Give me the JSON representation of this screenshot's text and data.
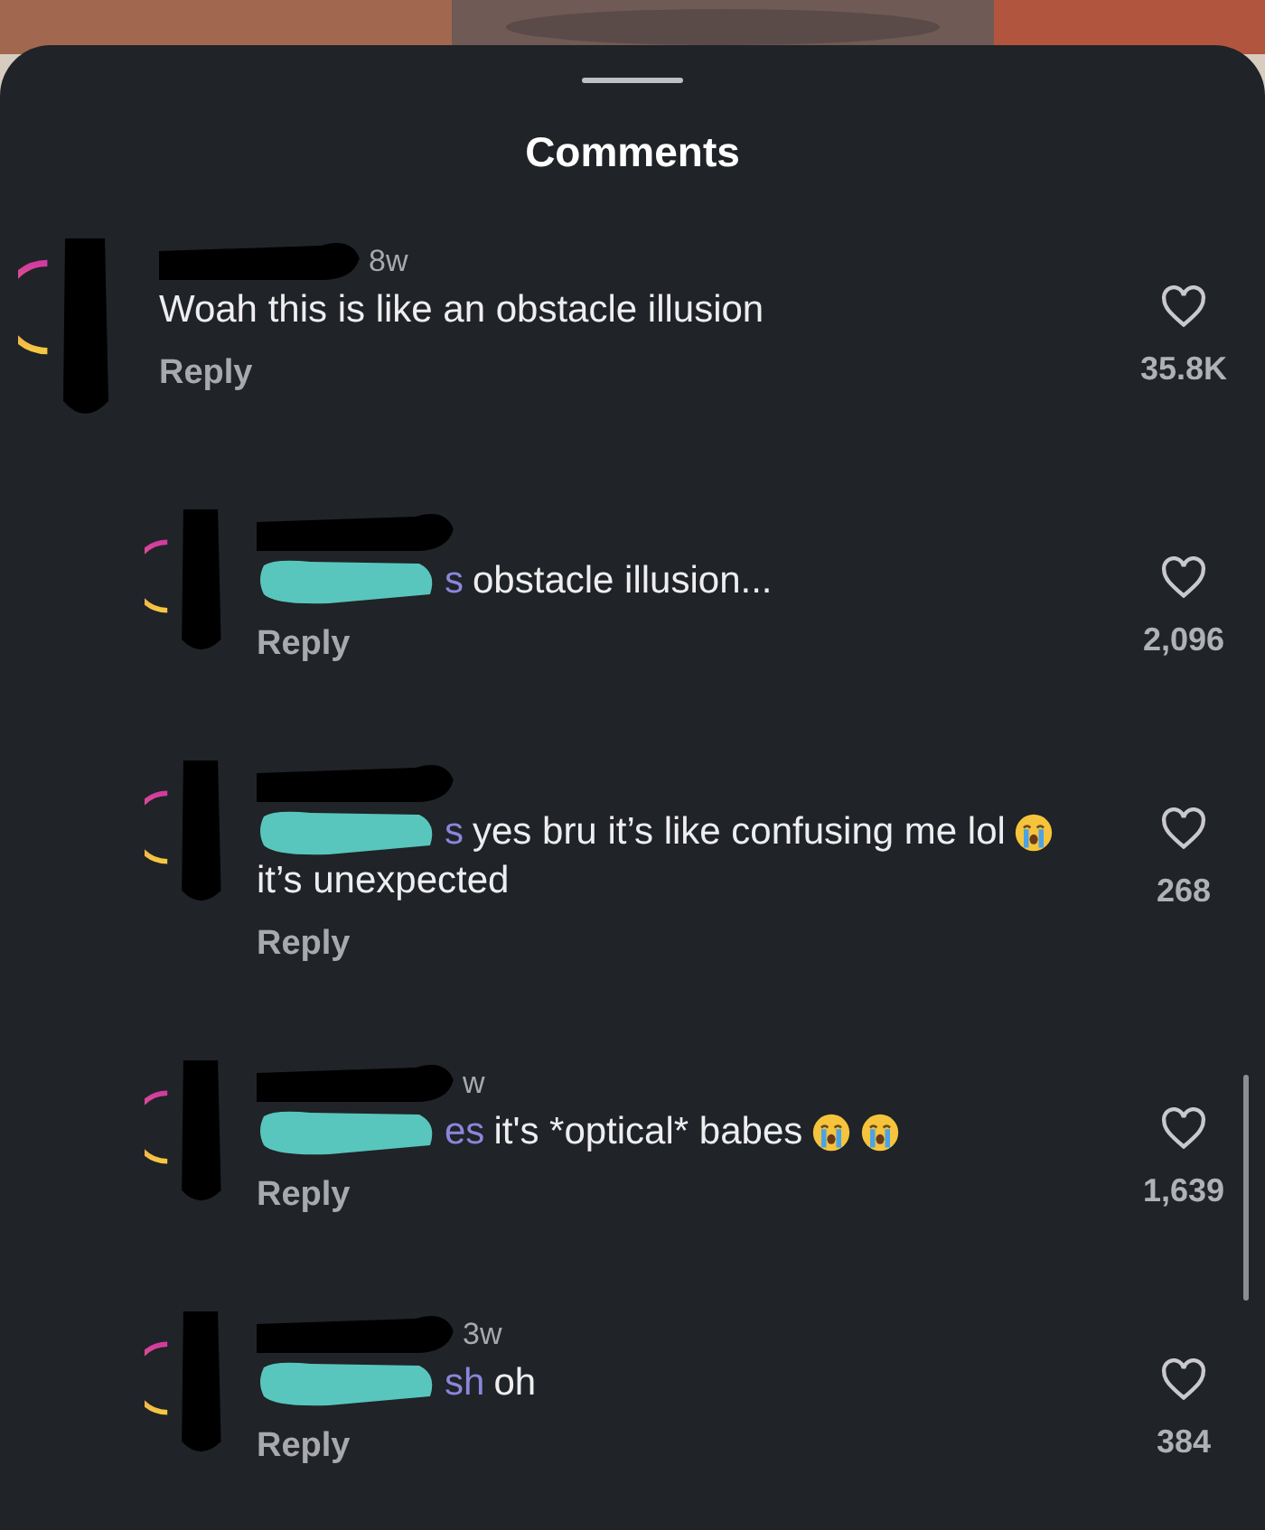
{
  "sheet": {
    "title": "Comments"
  },
  "comments": [
    {
      "kind": "top",
      "time": "8w",
      "lines": [
        "Woah this is like an obstacle illusion"
      ],
      "reply": "Reply",
      "likes": "35.8K",
      "redacted": true
    },
    {
      "kind": "reply",
      "mention": "s",
      "lines": [
        "obstacle illusion..."
      ],
      "reply": "Reply",
      "likes": "2,096",
      "redacted": true
    },
    {
      "kind": "reply",
      "mention": "s",
      "lines": [
        "yes bru it’s like confusing me lol",
        "it’s unexpected"
      ],
      "emojis": [
        {
          "kind": "crying"
        }
      ],
      "reply": "Reply",
      "likes": "268",
      "redacted": true
    },
    {
      "kind": "reply",
      "time": "w",
      "mention": "es",
      "lines": [
        "it's *optical* babes"
      ],
      "emojis": [
        {
          "kind": "crying"
        },
        {
          "kind": "crying"
        }
      ],
      "reply": "Reply",
      "likes": "1,639",
      "redacted": true
    },
    {
      "kind": "reply",
      "time": "3w",
      "mention": "sh",
      "lines": [
        "oh"
      ],
      "reply": "Reply",
      "likes": "384",
      "redacted": true
    }
  ]
}
